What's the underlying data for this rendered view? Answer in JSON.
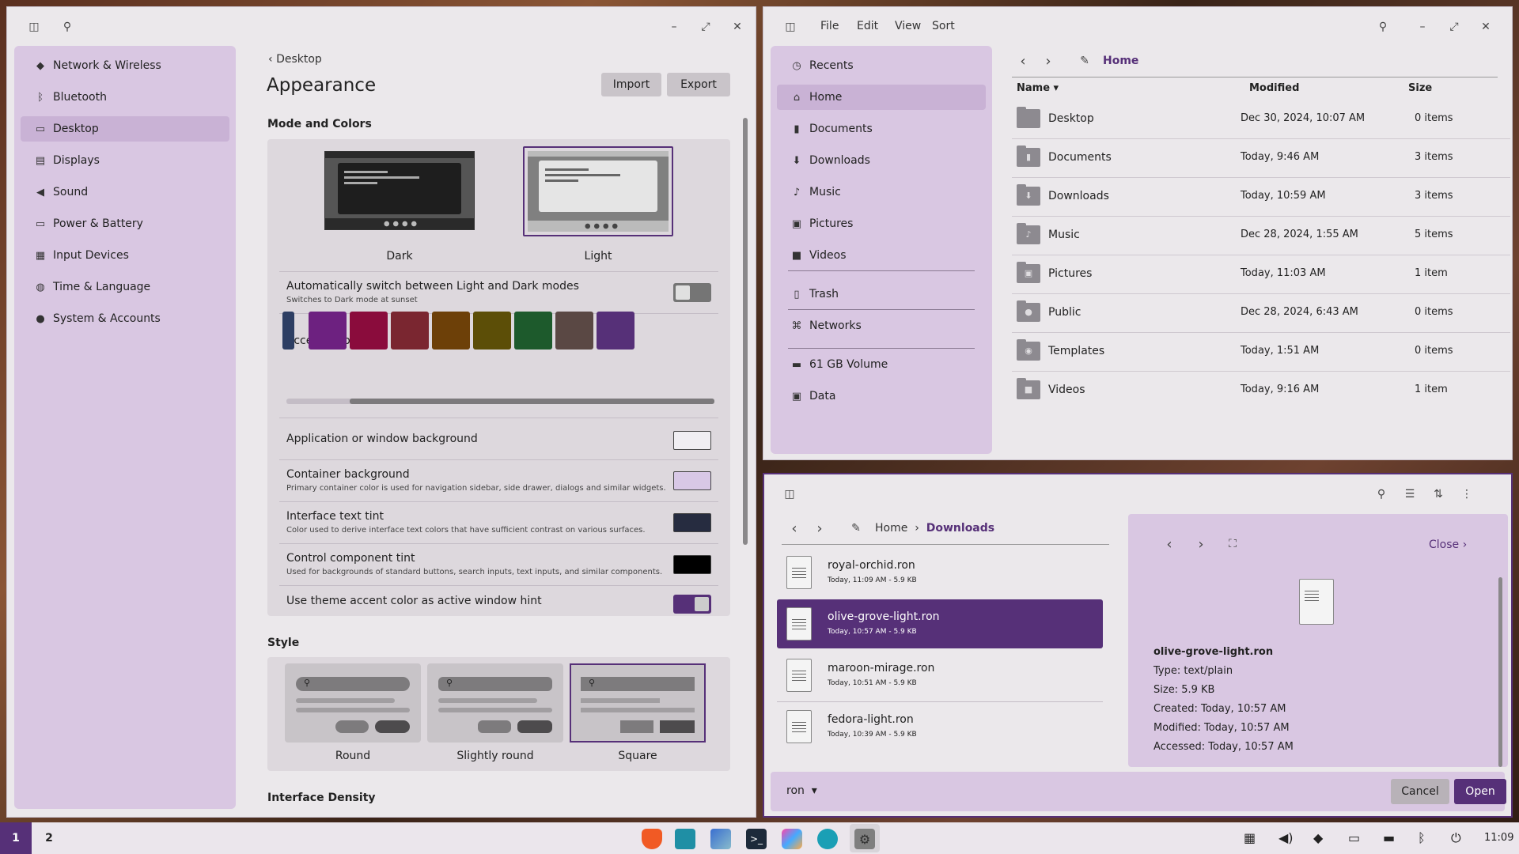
{
  "settings": {
    "sidebar": [
      {
        "label": "Network & Wireless",
        "icon": "wifi-icon",
        "glyph": "◆"
      },
      {
        "label": "Bluetooth",
        "icon": "bluetooth-icon",
        "glyph": "ᛒ"
      },
      {
        "label": "Desktop",
        "icon": "desktop-icon",
        "glyph": "▭",
        "active": true
      },
      {
        "label": "Displays",
        "icon": "display-icon",
        "glyph": "▤"
      },
      {
        "label": "Sound",
        "icon": "speaker-icon",
        "glyph": "◀"
      },
      {
        "label": "Power & Battery",
        "icon": "battery-icon",
        "glyph": "▭"
      },
      {
        "label": "Input Devices",
        "icon": "keyboard-icon",
        "glyph": "▦"
      },
      {
        "label": "Time & Language",
        "icon": "globe-icon",
        "glyph": "◍"
      },
      {
        "label": "System & Accounts",
        "icon": "users-icon",
        "glyph": "●"
      }
    ],
    "breadcrumb": "Desktop",
    "title": "Appearance",
    "import": "Import",
    "export": "Export",
    "mode_heading": "Mode and Colors",
    "dark": "Dark",
    "light": "Light",
    "auto_title": "Automatically switch between Light and Dark modes",
    "auto_sub": "Switches to Dark mode at sunset",
    "accent_label": "Accent color",
    "accents": [
      "#2d3e63",
      "#6d2180",
      "#8a0c3c",
      "#7a2630",
      "#6d4008",
      "#5c4e07",
      "#1d5a2c",
      "#5a4844",
      "#563078"
    ],
    "bg_title": "Application or window background",
    "bg_color": "#f0eef2",
    "container_title": "Container background",
    "container_sub": "Primary container color is used for navigation sidebar, side drawer, dialogs and similar widgets.",
    "container_color": "#d8c8e6",
    "text_tint_title": "Interface text tint",
    "text_tint_sub": "Color used to derive interface text colors that have sufficient contrast on various surfaces.",
    "text_tint_color": "#262c40",
    "control_title": "Control component tint",
    "control_sub": "Used for backgrounds of standard buttons, search inputs, text inputs, and similar components.",
    "control_color": "#000000",
    "hint_title": "Use theme accent color as active window hint",
    "style_heading": "Style",
    "style_round": "Round",
    "style_slightly": "Slightly round",
    "style_square": "Square",
    "density_heading": "Interface Density"
  },
  "files": {
    "menu": [
      "File",
      "Edit",
      "View",
      "Sort"
    ],
    "places": [
      {
        "label": "Recents",
        "icon": "clock-icon",
        "glyph": "◷"
      },
      {
        "label": "Home",
        "icon": "home-icon",
        "glyph": "⌂",
        "active": true
      },
      {
        "label": "Documents",
        "icon": "document-icon",
        "glyph": "▮"
      },
      {
        "label": "Downloads",
        "icon": "download-icon",
        "glyph": "⬇"
      },
      {
        "label": "Music",
        "icon": "music-icon",
        "glyph": "♪"
      },
      {
        "label": "Pictures",
        "icon": "image-icon",
        "glyph": "▣"
      },
      {
        "label": "Videos",
        "icon": "video-icon",
        "glyph": "■"
      },
      {
        "label": "Trash",
        "icon": "trash-icon",
        "glyph": "▯"
      },
      {
        "label": "Networks",
        "icon": "network-icon",
        "glyph": "⌘"
      },
      {
        "label": "61 GB Volume",
        "icon": "drive-icon",
        "glyph": "▬"
      },
      {
        "label": "Data",
        "icon": "disk-icon",
        "glyph": "▣"
      }
    ],
    "location": "Home",
    "col_name": "Name",
    "col_modified": "Modified",
    "col_size": "Size",
    "rows": [
      {
        "name": "Desktop",
        "modified": "Dec 30, 2024, 10:07 AM",
        "size": "0 items",
        "glyph": ""
      },
      {
        "name": "Documents",
        "modified": "Today, 9:46 AM",
        "size": "3 items",
        "glyph": "▮"
      },
      {
        "name": "Downloads",
        "modified": "Today, 10:59 AM",
        "size": "3 items",
        "glyph": "⬇"
      },
      {
        "name": "Music",
        "modified": "Dec 28, 2024, 1:55 AM",
        "size": "5 items",
        "glyph": "♪"
      },
      {
        "name": "Pictures",
        "modified": "Today, 11:03 AM",
        "size": "1 item",
        "glyph": "▣"
      },
      {
        "name": "Public",
        "modified": "Dec 28, 2024, 6:43 AM",
        "size": "0 items",
        "glyph": "●"
      },
      {
        "name": "Templates",
        "modified": "Today, 1:51 AM",
        "size": "0 items",
        "glyph": "◉"
      },
      {
        "name": "Videos",
        "modified": "Today, 9:16 AM",
        "size": "1 item",
        "glyph": "■"
      }
    ]
  },
  "dialog": {
    "crumb_home": "Home",
    "crumb_current": "Downloads",
    "items": [
      {
        "name": "royal-orchid.ron",
        "meta": "Today, 11:09 AM - 5.9 KB"
      },
      {
        "name": "olive-grove-light.ron",
        "meta": "Today, 10:57 AM - 5.9 KB",
        "selected": true
      },
      {
        "name": "maroon-mirage.ron",
        "meta": "Today, 10:51 AM - 5.9 KB"
      },
      {
        "name": "fedora-light.ron",
        "meta": "Today, 10:39 AM - 5.9 KB"
      }
    ],
    "close": "Close",
    "preview_name": "olive-grove-light.ron",
    "preview_type": "Type: text/plain",
    "preview_size": "Size: 5.9 KB",
    "preview_created": "Created: Today, 10:57 AM",
    "preview_modified": "Modified: Today, 10:57 AM",
    "preview_accessed": "Accessed: Today, 10:57 AM",
    "filter": "ron",
    "cancel": "Cancel",
    "open": "Open"
  },
  "taskbar": {
    "ws1": "1",
    "ws2": "2",
    "clock": "11:09"
  }
}
